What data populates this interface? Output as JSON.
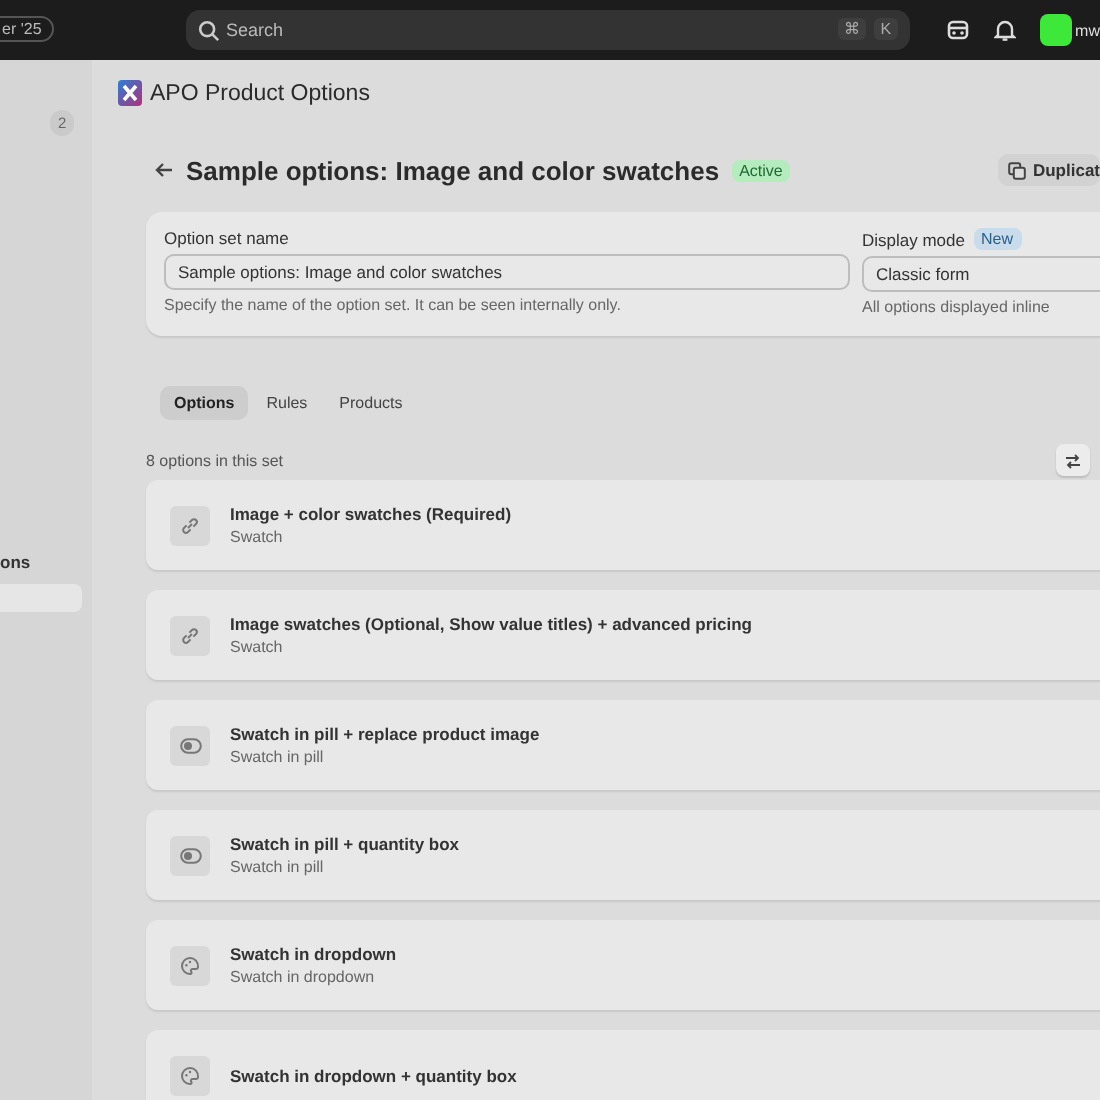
{
  "topbar": {
    "edition_pill": "er '25",
    "search": {
      "placeholder": "Search",
      "shortcut": [
        "⌘",
        "K"
      ]
    },
    "user": "mw"
  },
  "sidebar": {
    "badge": "2",
    "items": [
      {
        "label": "ons",
        "selected": false
      },
      {
        "selected": true
      }
    ]
  },
  "app": {
    "title": "APO Product Options"
  },
  "page": {
    "title": "Sample options: Image and color swatches",
    "status": "Active",
    "duplicate_button": "Duplicat"
  },
  "settings": {
    "name_label": "Option set name",
    "name_value": "Sample options: Image and color swatches",
    "name_help": "Specify the name of the option set. It can be seen internally only.",
    "mode_label": "Display mode",
    "mode_badge": "New",
    "mode_value": "Classic form",
    "mode_help": "All options displayed inline"
  },
  "tabs": [
    {
      "label": "Options",
      "selected": true
    },
    {
      "label": "Rules",
      "selected": false
    },
    {
      "label": "Products",
      "selected": false
    }
  ],
  "count": "8 options in this set",
  "options": [
    {
      "kind": "link",
      "title": "Image + color swatches (Required)",
      "type": "Swatch"
    },
    {
      "kind": "link",
      "title": "Image swatches (Optional, Show value titles) + advanced pricing",
      "type": "Swatch"
    },
    {
      "kind": "pill",
      "title": "Swatch in pill + replace product image",
      "type": "Swatch in pill"
    },
    {
      "kind": "pill",
      "title": "Swatch in pill + quantity box",
      "type": "Swatch in pill"
    },
    {
      "kind": "dropdown",
      "title": "Swatch in dropdown",
      "type": "Swatch in dropdown"
    },
    {
      "kind": "dropdown",
      "title": "Swatch in dropdown + quantity box"
    }
  ]
}
